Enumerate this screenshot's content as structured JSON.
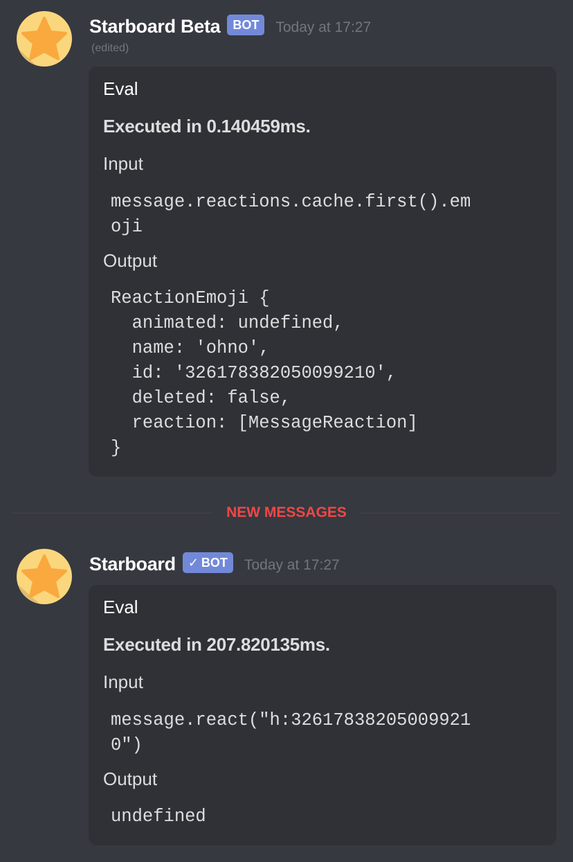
{
  "messages": [
    {
      "username": "Starboard Beta",
      "bot_tag": "BOT",
      "verified": false,
      "timestamp": "Today at 17:27",
      "edited_label": "(edited)",
      "embed": {
        "title": "Eval",
        "description": "Executed in 0.140459ms.",
        "fields": [
          {
            "name": "Input",
            "code": "message.reactions.cache.first().em\noji"
          },
          {
            "name": "Output",
            "code": "ReactionEmoji {\n  animated: undefined,\n  name: 'ohno',\n  id: '326178382050099210',\n  deleted: false,\n  reaction: [MessageReaction]\n}"
          }
        ]
      }
    },
    {
      "username": "Starboard",
      "bot_tag": "BOT",
      "verified": true,
      "verified_mark": "✓",
      "timestamp": "Today at 17:27",
      "embed": {
        "title": "Eval",
        "description": "Executed in 207.820135ms.",
        "fields": [
          {
            "name": "Input",
            "code": "message.react(\"h:32617838205009921\n0\")"
          },
          {
            "name": "Output",
            "code": "undefined"
          }
        ]
      }
    }
  ],
  "divider": {
    "label": "NEW MESSAGES"
  },
  "icons": {
    "avatar": "star-avatar-icon",
    "verified": "checkmark-icon"
  },
  "colors": {
    "background": "#36393f",
    "embed_background": "#2f3136",
    "bot_tag": "#7289da",
    "new_messages": "#f04747",
    "timestamp": "#72767d",
    "avatar_circle": "#fad77d",
    "star": "#f9a93e"
  }
}
